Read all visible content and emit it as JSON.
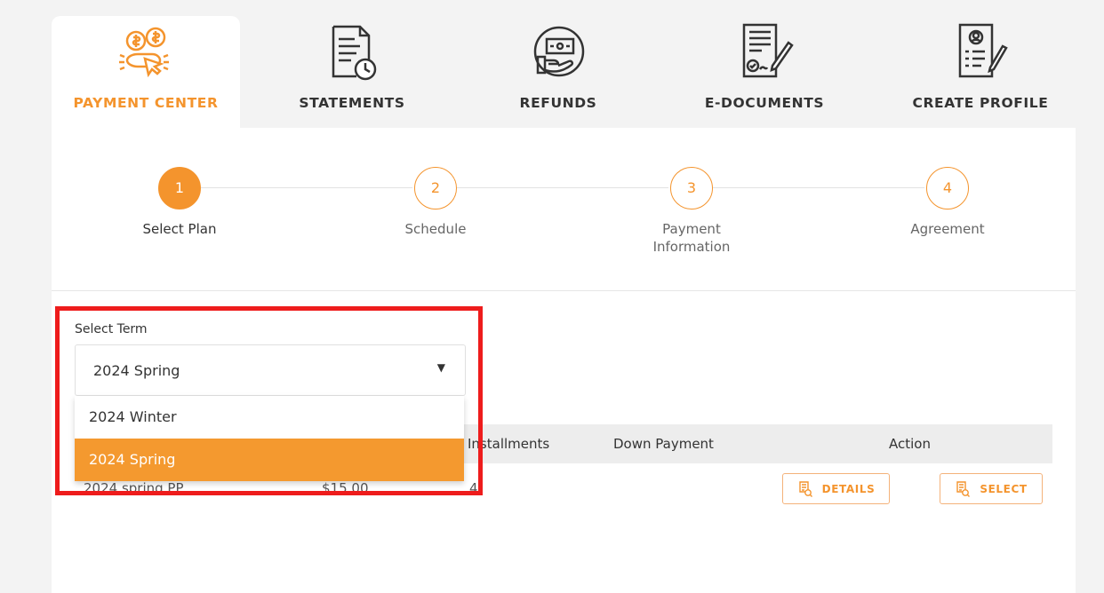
{
  "nav": {
    "tabs": [
      {
        "label": "PAYMENT CENTER",
        "icon": "payment-center-icon",
        "active": true
      },
      {
        "label": "STATEMENTS",
        "icon": "statements-icon",
        "active": false
      },
      {
        "label": "REFUNDS",
        "icon": "refunds-icon",
        "active": false
      },
      {
        "label": "E-DOCUMENTS",
        "icon": "e-documents-icon",
        "active": false
      },
      {
        "label": "CREATE PROFILE",
        "icon": "create-profile-icon",
        "active": false
      }
    ]
  },
  "steps": [
    {
      "number": "1",
      "label": "Select Plan",
      "active": true
    },
    {
      "number": "2",
      "label": "Schedule",
      "active": false
    },
    {
      "number": "3",
      "label": "Payment\nInformation",
      "active": false
    },
    {
      "number": "4",
      "label": "Agreement",
      "active": false
    }
  ],
  "term": {
    "label": "Select Term",
    "selected": "2024 Spring",
    "options": [
      "2024 Winter",
      "2024 Spring"
    ]
  },
  "table": {
    "headers": {
      "installments": "Installments",
      "down_payment": "Down Payment",
      "action": "Action"
    },
    "row": {
      "plan": "2024 spring PP",
      "fee": "$15.00",
      "installments": "4"
    },
    "details_label": "DETAILS",
    "select_label": "SELECT"
  },
  "colors": {
    "accent": "#f4942d",
    "highlight": "#ee1c1c"
  }
}
